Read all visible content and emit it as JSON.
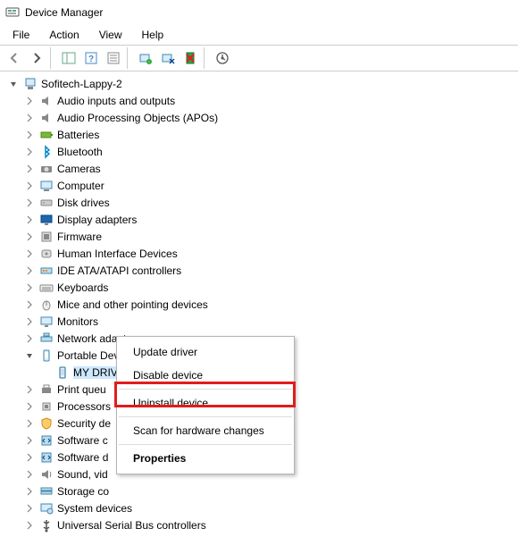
{
  "title": "Device Manager",
  "menu": {
    "file": "File",
    "action": "Action",
    "view": "View",
    "help": "Help"
  },
  "root": "Sofitech-Lappy-2",
  "categories": [
    {
      "label": "Audio inputs and outputs",
      "icon": "audio"
    },
    {
      "label": "Audio Processing Objects (APOs)",
      "icon": "audio"
    },
    {
      "label": "Batteries",
      "icon": "battery"
    },
    {
      "label": "Bluetooth",
      "icon": "bluetooth"
    },
    {
      "label": "Cameras",
      "icon": "camera"
    },
    {
      "label": "Computer",
      "icon": "computer"
    },
    {
      "label": "Disk drives",
      "icon": "disk"
    },
    {
      "label": "Display adapters",
      "icon": "display"
    },
    {
      "label": "Firmware",
      "icon": "firmware"
    },
    {
      "label": "Human Interface Devices",
      "icon": "hid"
    },
    {
      "label": "IDE ATA/ATAPI controllers",
      "icon": "ide"
    },
    {
      "label": "Keyboards",
      "icon": "keyboard"
    },
    {
      "label": "Mice and other pointing devices",
      "icon": "mouse"
    },
    {
      "label": "Monitors",
      "icon": "monitor"
    },
    {
      "label": "Network adapters",
      "icon": "network"
    },
    {
      "label": "Portable Devices",
      "icon": "portable",
      "expanded": true,
      "children": [
        {
          "label": "MY DRIVE",
          "icon": "drive",
          "selected": true
        }
      ]
    },
    {
      "label": "Print queues",
      "icon": "printer",
      "truncated": "Print queu"
    },
    {
      "label": "Processors",
      "icon": "cpu",
      "truncated": "Processors"
    },
    {
      "label": "Security devices",
      "icon": "security",
      "truncated": "Security de"
    },
    {
      "label": "Software components",
      "icon": "software",
      "truncated": "Software c"
    },
    {
      "label": "Software devices",
      "icon": "software",
      "truncated": "Software d"
    },
    {
      "label": "Sound, video and game controllers",
      "icon": "sound",
      "truncated": "Sound, vid"
    },
    {
      "label": "Storage controllers",
      "icon": "storage",
      "truncated": "Storage co"
    },
    {
      "label": "System devices",
      "icon": "system"
    },
    {
      "label": "Universal Serial Bus controllers",
      "icon": "usb"
    }
  ],
  "context_menu": {
    "update": "Update driver",
    "disable": "Disable device",
    "uninstall": "Uninstall device",
    "scan": "Scan for hardware changes",
    "properties": "Properties"
  }
}
